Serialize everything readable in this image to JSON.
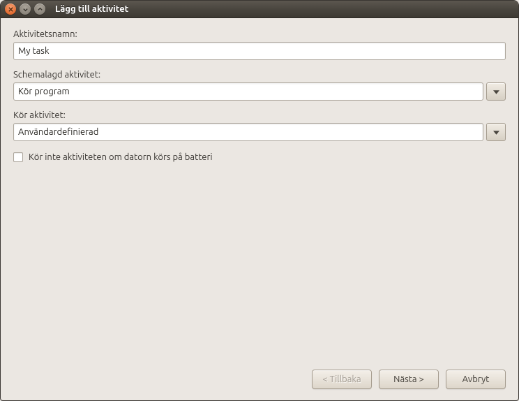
{
  "window": {
    "title": "Lägg till aktivitet"
  },
  "labels": {
    "activity_name": "Aktivitetsnamn:",
    "scheduled_activity": "Schemalagd aktivitet:",
    "run_activity": "Kör aktivitet:",
    "battery_checkbox": "Kör inte aktiviteten om datorn körs på batteri"
  },
  "fields": {
    "activity_name": {
      "value": "My task",
      "placeholder": ""
    },
    "scheduled_activity": {
      "value": "Kör program"
    },
    "run_activity": {
      "value": "Användardefinierad"
    },
    "battery_checked": false
  },
  "footer": {
    "back": "< Tillbaka",
    "next": "Nästa >",
    "cancel": "Avbryt"
  }
}
